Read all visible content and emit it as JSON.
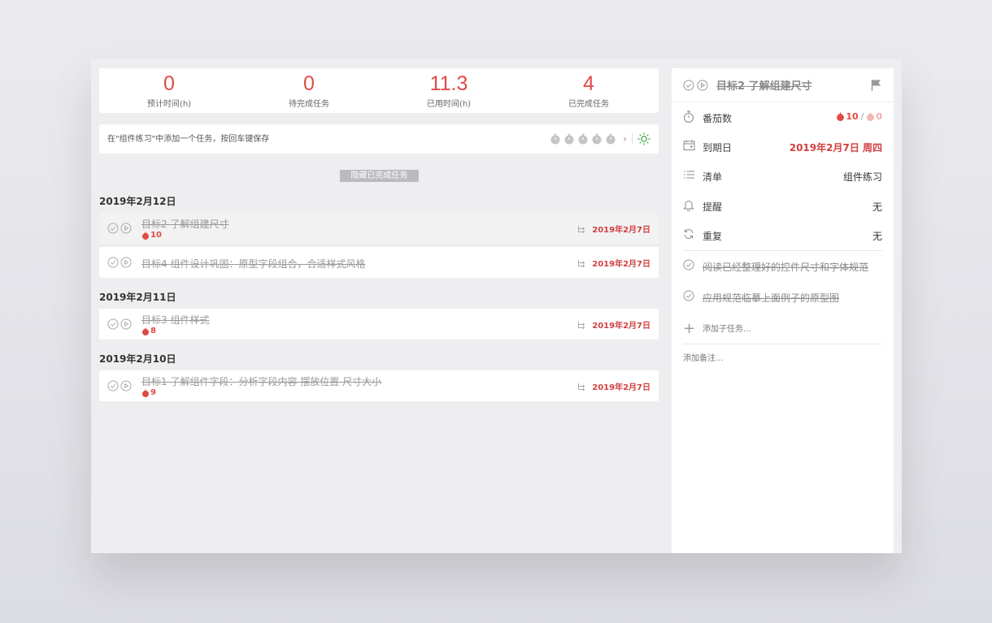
{
  "colors": {
    "accent": "#e04a44",
    "date_red": "#d24040",
    "muted": "#9a9a9a"
  },
  "stats": [
    {
      "value": "0",
      "label": "预计时间(h)"
    },
    {
      "value": "0",
      "label": "待完成任务"
    },
    {
      "value": "11.3",
      "label": "已用时间(h)"
    },
    {
      "value": "4",
      "label": "已完成任务"
    }
  ],
  "add_task": {
    "placeholder": "在\"组件练习\"中添加一个任务，按回车键保存",
    "estimate_icons": [
      "stopwatch-icon",
      "stopwatch-icon",
      "stopwatch-icon",
      "stopwatch-icon",
      "stopwatch-icon"
    ],
    "more_icon": "chevron-right-icon",
    "settings_icon": "sun-icon"
  },
  "hide_completed_label": "隐藏已完成任务",
  "groups": [
    {
      "date": "2019年2月12日",
      "tasks": [
        {
          "title": "目标2 了解组建尺寸",
          "pomodoros": "10",
          "due": "2019年2月7日"
        },
        {
          "title": "目标4 组件设计巩固：原型字段组合，合适样式风格",
          "due": "2019年2月7日"
        }
      ]
    },
    {
      "date": "2019年2月11日",
      "tasks": [
        {
          "title": "目标3 组件样式",
          "pomodoros": "8",
          "due": "2019年2月7日"
        }
      ]
    },
    {
      "date": "2019年2月10日",
      "tasks": [
        {
          "title": "目标1 了解组件字段：分析字段内容 摆放位置 尺寸大小",
          "pomodoros": "9",
          "due": "2019年2月7日"
        }
      ]
    }
  ],
  "detail": {
    "title": "目标2 了解组建尺寸",
    "pomodoro": {
      "label": "番茄数",
      "done": "10",
      "separator": "/",
      "estimated": "0"
    },
    "due": {
      "label": "到期日",
      "value": "2019年2月7日 周四"
    },
    "list": {
      "label": "清单",
      "value": "组件练习"
    },
    "reminder": {
      "label": "提醒",
      "value": "无"
    },
    "repeat": {
      "label": "重复",
      "value": "无"
    },
    "subtasks": [
      {
        "title": "阅读已经整理好的控件尺寸和字体规范"
      },
      {
        "title": "应用规范临摹上面例子的原型图"
      }
    ],
    "add_subtask_placeholder": "添加子任务...",
    "note_placeholder": "添加备注..."
  }
}
